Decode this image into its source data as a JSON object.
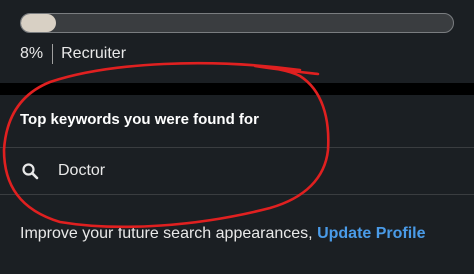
{
  "progress": {
    "value_percent": 8,
    "label": "8%",
    "role": "Recruiter"
  },
  "keywords": {
    "title": "Top keywords you were found for",
    "items": [
      {
        "icon": "search-icon",
        "text": "Doctor"
      }
    ]
  },
  "footer": {
    "text": "Improve your future search appearances,",
    "link_label": "Update Profile"
  },
  "colors": {
    "background": "#000000",
    "panel": "#1b1f23",
    "link": "#4a9be8",
    "annotation": "#e02020",
    "progress_fill": "#d8d0c4"
  }
}
